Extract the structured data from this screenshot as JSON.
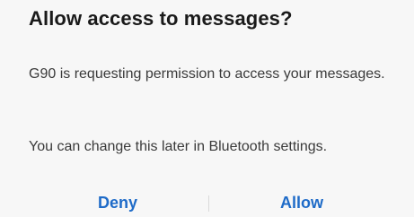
{
  "dialog": {
    "title": "Allow access to messages?",
    "message": "G90 is requesting permission to access your messages.",
    "note": "You can change this later in Bluetooth settings.",
    "buttons": {
      "deny": "Deny",
      "allow": "Allow"
    }
  },
  "colors": {
    "background": "#f7f7f7",
    "title": "#1a1a1a",
    "body_text": "#3a3a3a",
    "accent": "#1e6bc8"
  }
}
